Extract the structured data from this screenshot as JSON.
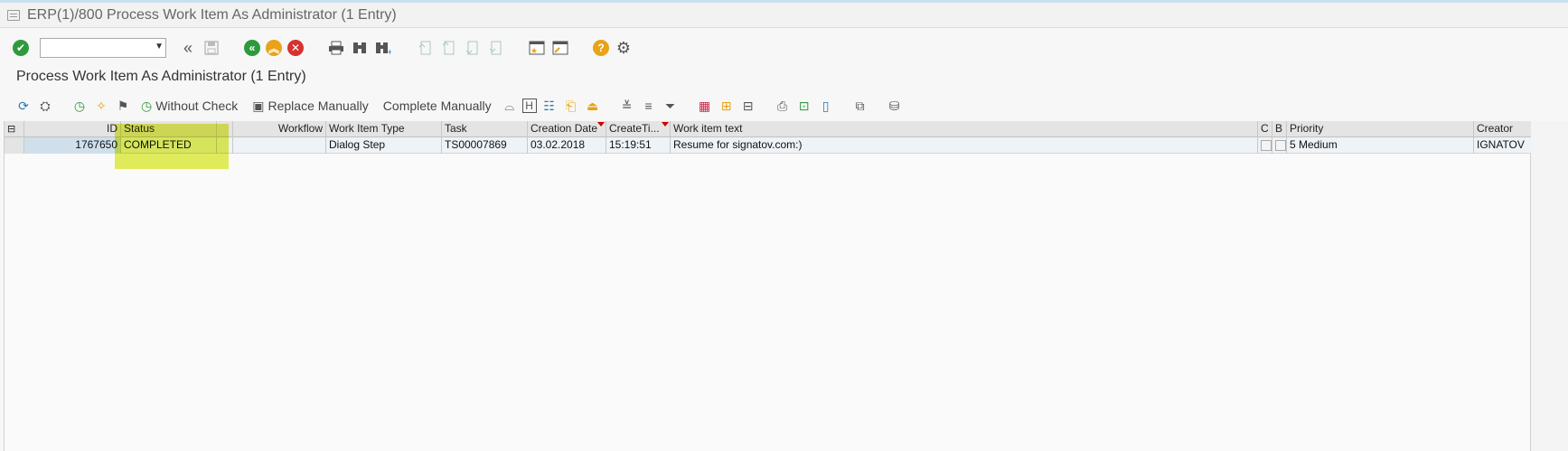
{
  "window": {
    "title": "ERP(1)/800 Process Work Item As Administrator (1 Entry)"
  },
  "std_toolbar": {
    "command_field_value": "",
    "icons": [
      "enter-check-icon",
      "back-double-icon",
      "save-icon",
      "back-icon",
      "exit-icon",
      "cancel-icon",
      "print-icon",
      "find-icon",
      "find-next-icon",
      "first-page-icon",
      "prev-page-icon",
      "next-page-icon",
      "last-page-icon",
      "new-session-icon",
      "shortcut-icon",
      "help-icon",
      "settings-icon"
    ]
  },
  "page": {
    "title": "Process Work Item As Administrator (1 Entry)"
  },
  "app_toolbar": {
    "without_check": "Without Check",
    "replace_manually": "Replace Manually",
    "complete_manually": "Complete Manually"
  },
  "table": {
    "columns": [
      "ID",
      "Status",
      "",
      "Workflow",
      "Work Item Type",
      "Task",
      "Creation Date",
      "CreateTi...",
      "Work item text",
      "C",
      "B",
      "Priority",
      "Creator"
    ],
    "rows": [
      {
        "id": "1767650",
        "status": "COMPLETED",
        "blank": "",
        "workflow": "",
        "type": "Dialog Step",
        "task": "TS00007869",
        "date": "03.02.2018",
        "time": "15:19:51",
        "text": "Resume for signatov.com:)",
        "c": "",
        "b": "",
        "priority": "5 Medium",
        "creator": "IGNATOV"
      }
    ]
  },
  "colors": {
    "highlight": "#dceb28",
    "id_cell_bg": "#cfe0ec",
    "green_icon": "#2e9a3e",
    "red_icon": "#d6322f",
    "orange_icon": "#e8a317"
  }
}
